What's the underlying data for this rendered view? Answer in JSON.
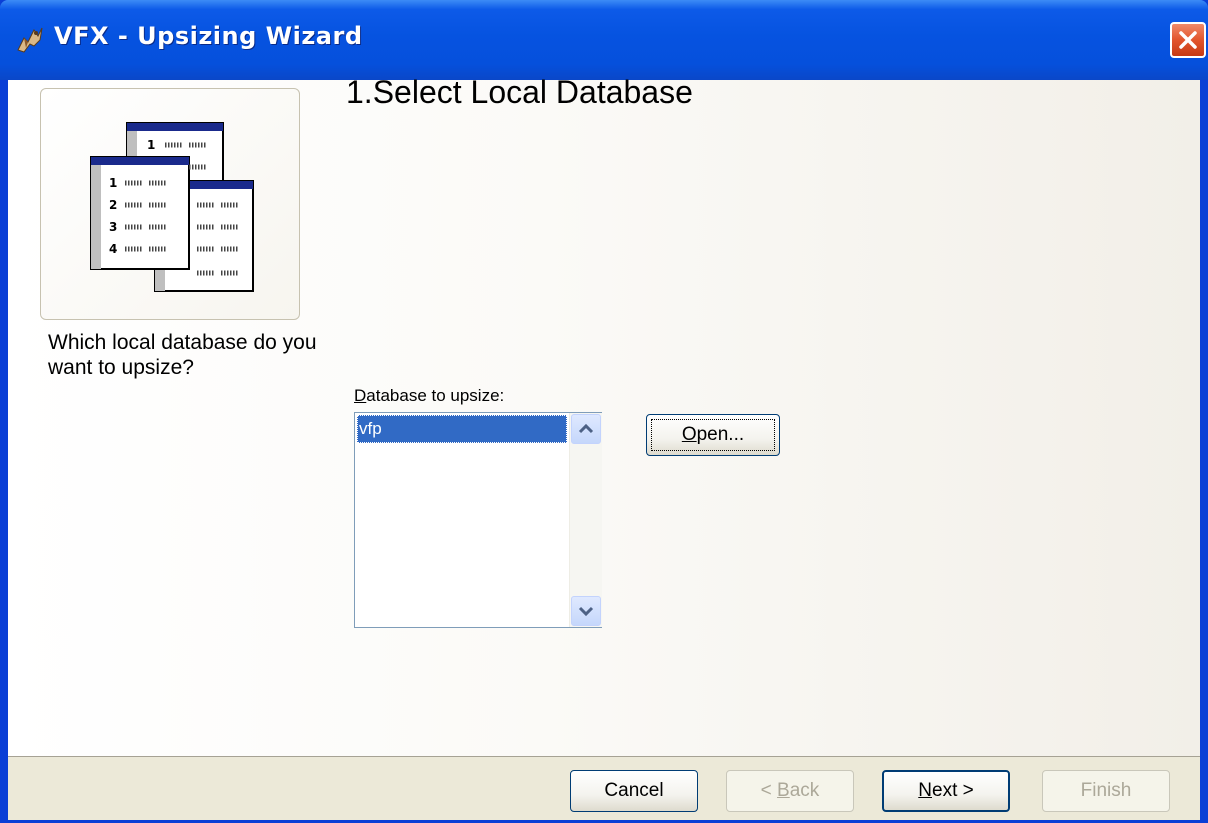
{
  "window": {
    "title": "VFX - Upsizing Wizard"
  },
  "sidebar": {
    "prompt": "Which local database do you want to upsize?",
    "illustration_rows": [
      "1",
      "2",
      "3",
      "4"
    ]
  },
  "main": {
    "step_title": "1.Select Local Database",
    "database_label": "Database to upsize:",
    "database_label_mnemonic": "D",
    "database_list": {
      "items": [
        "vfp"
      ],
      "selected": "vfp"
    },
    "open_button": {
      "label": "Open...",
      "mnemonic": "O"
    }
  },
  "footer": {
    "cancel_label": "Cancel",
    "back_label": "< Back",
    "back_mnemonic": "B",
    "next_label": "Next >",
    "next_mnemonic": "N",
    "finish_label": "Finish"
  },
  "colors": {
    "titlebar": "#0653e0",
    "selection": "#316ac5",
    "close_button": "#e2552c",
    "footer_bg": "#ece9d8"
  }
}
